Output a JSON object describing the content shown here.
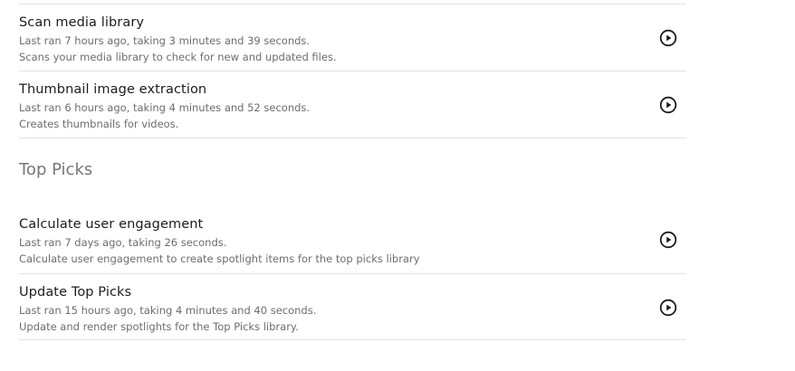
{
  "groups": [
    {
      "heading": "",
      "tasks": [
        {
          "title": "Scan media library",
          "meta": "Last ran 7 hours ago, taking 3 minutes and 39 seconds.",
          "description": "Scans your media library to check for new and updated files.",
          "action_icon": "play-circle-icon"
        },
        {
          "title": "Thumbnail image extraction",
          "meta": "Last ran 6 hours ago, taking 4 minutes and 52 seconds.",
          "description": "Creates thumbnails for videos.",
          "action_icon": "play-circle-icon"
        }
      ]
    },
    {
      "heading": "Top Picks",
      "tasks": [
        {
          "title": "Calculate user engagement",
          "meta": "Last ran 7 days ago, taking 26 seconds.",
          "description": "Calculate user engagement to create spotlight items for the top picks library",
          "action_icon": "play-circle-icon"
        },
        {
          "title": "Update Top Picks",
          "meta": "Last ran 15 hours ago, taking 4 minutes and 40 seconds.",
          "description": "Update and render spotlights for the Top Picks library.",
          "action_icon": "play-circle-icon"
        }
      ]
    }
  ],
  "colors": {
    "title": "#1c1c1c",
    "secondary_text": "#6d6d6d",
    "section_heading": "#777777",
    "divider": "#e2e2e2",
    "icon": "#1c1c1c"
  }
}
